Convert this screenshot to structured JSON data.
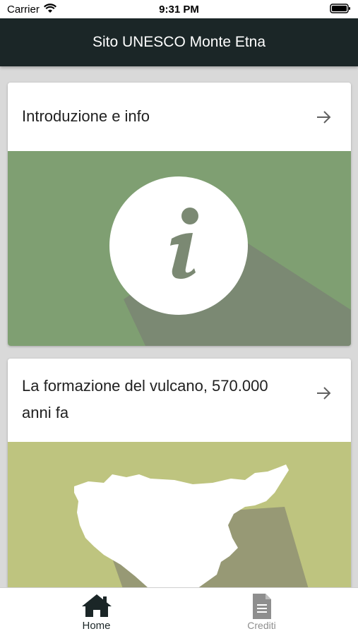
{
  "status_bar": {
    "carrier": "Carrier",
    "time": "9:31 PM"
  },
  "nav": {
    "title": "Sito UNESCO Monte Etna"
  },
  "cards": [
    {
      "title": "Introduzione e info",
      "image_color": "#7f9f72"
    },
    {
      "title": "La formazione del vulcano, 570.000 anni fa",
      "image_color": "#bec47f"
    }
  ],
  "tabs": [
    {
      "label": "Home",
      "selected": true,
      "color": "#1b2627"
    },
    {
      "label": "Crediti",
      "selected": false,
      "color": "#8e8e8e"
    }
  ],
  "icons": [
    "wifi-icon",
    "battery-icon",
    "arrow-right-icon",
    "info-icon",
    "map-icon",
    "home-icon",
    "document-icon"
  ]
}
